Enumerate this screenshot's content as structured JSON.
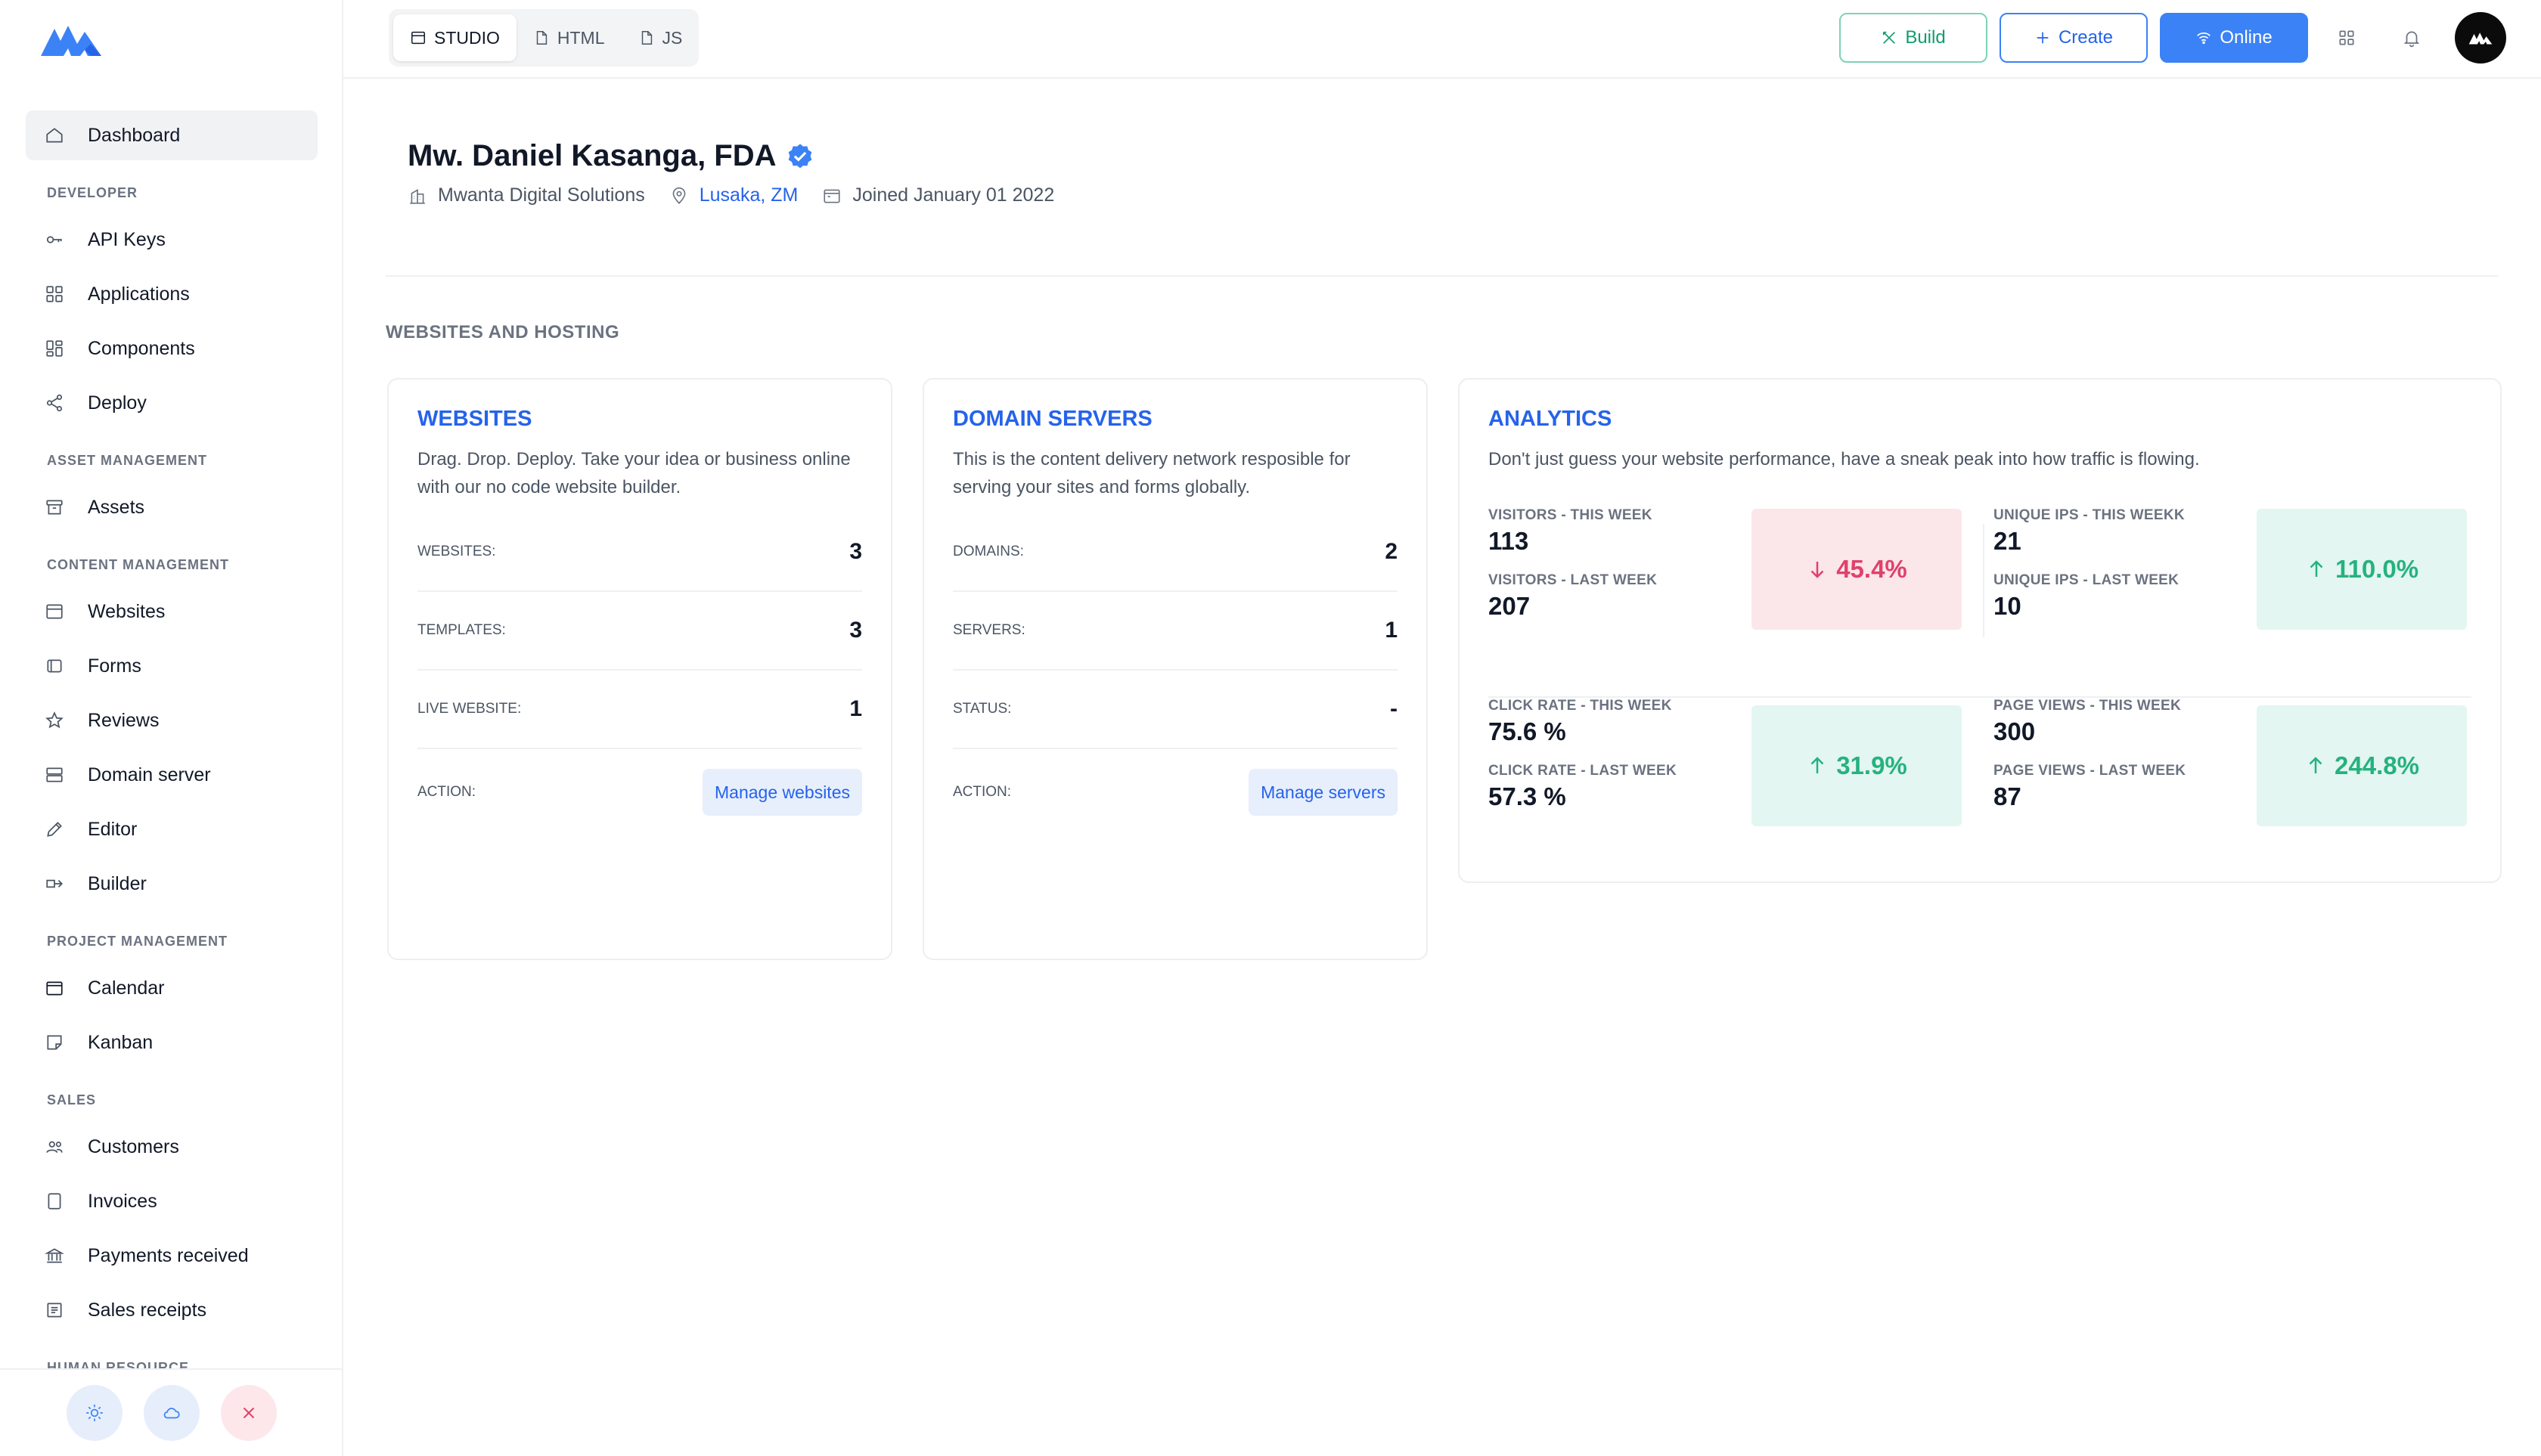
{
  "topbar": {
    "tabs": [
      {
        "label": "STUDIO",
        "icon": "window-icon"
      },
      {
        "label": "HTML",
        "icon": "file-icon"
      },
      {
        "label": "JS",
        "icon": "file-icon"
      }
    ],
    "build_label": "Build",
    "create_label": "Create",
    "online_label": "Online"
  },
  "sidebar": {
    "dashboard": "Dashboard",
    "sections": {
      "developer": "DEVELOPER",
      "asset_management": "ASSET MANAGEMENT",
      "content_management": "CONTENT MANAGEMENT",
      "project_management": "PROJECT MANAGEMENT",
      "sales": "SALES",
      "human_resource": "HUMAN RESOURCE"
    },
    "items": {
      "api_keys": "API Keys",
      "applications": "Applications",
      "components": "Components",
      "deploy": "Deploy",
      "assets": "Assets",
      "websites": "Websites",
      "forms": "Forms",
      "reviews": "Reviews",
      "domain_server": "Domain server",
      "editor": "Editor",
      "builder": "Builder",
      "calendar": "Calendar",
      "kanban": "Kanban",
      "customers": "Customers",
      "invoices": "Invoices",
      "payments_received": "Payments received",
      "sales_receipts": "Sales receipts"
    }
  },
  "profile": {
    "name": "Mw. Daniel Kasanga, FDA",
    "company": "Mwanta Digital Solutions",
    "location": "Lusaka, ZM",
    "joined": "Joined January 01 2022"
  },
  "section_title": "WEBSITES AND HOSTING",
  "websites_card": {
    "title": "WEBSITES",
    "description": "Drag. Drop. Deploy. Take your idea or business online with our no code website builder.",
    "rows": [
      {
        "label": "WEBSITES:",
        "value": "3"
      },
      {
        "label": "TEMPLATES:",
        "value": "3"
      },
      {
        "label": "LIVE WEBSITE:",
        "value": "1"
      }
    ],
    "action_label": "ACTION:",
    "button": "Manage websites"
  },
  "domain_card": {
    "title": "DOMAIN SERVERS",
    "description": "This is the content delivery network resposible for serving your sites and forms globally.",
    "rows": [
      {
        "label": "DOMAINS:",
        "value": "2"
      },
      {
        "label": "SERVERS:",
        "value": "1"
      },
      {
        "label": "STATUS:",
        "value": "-"
      }
    ],
    "action_label": "ACTION:",
    "button": "Manage servers"
  },
  "analytics": {
    "title": "ANALYTICS",
    "description": "Don't just guess your website performance, have a sneak peak into how traffic is flowing.",
    "visitors": {
      "this_label": "VISITORS - THIS WEEK",
      "this_value": "113",
      "last_label": "VISITORS - LAST WEEK",
      "last_value": "207",
      "delta": "45.4%",
      "direction": "down"
    },
    "unique_ips": {
      "this_label": "UNIQUE IPS - THIS WEEKK",
      "this_value": "21",
      "last_label": "UNIQUE IPS - LAST WEEK",
      "last_value": "10",
      "delta": "110.0%",
      "direction": "up"
    },
    "click_rate": {
      "this_label": "CLICK RATE - THIS WEEK",
      "this_value": "75.6 %",
      "last_label": "CLICK RATE - LAST WEEK",
      "last_value": "57.3 %",
      "delta": "31.9%",
      "direction": "up"
    },
    "page_views": {
      "this_label": "PAGE VIEWS - THIS WEEK",
      "this_value": "300",
      "last_label": "PAGE VIEWS - LAST WEEK",
      "last_value": "87",
      "delta": "244.8%",
      "direction": "up"
    }
  },
  "colors": {
    "accent": "#3b82f6",
    "success": "#25b27f",
    "danger": "#e0416a"
  }
}
